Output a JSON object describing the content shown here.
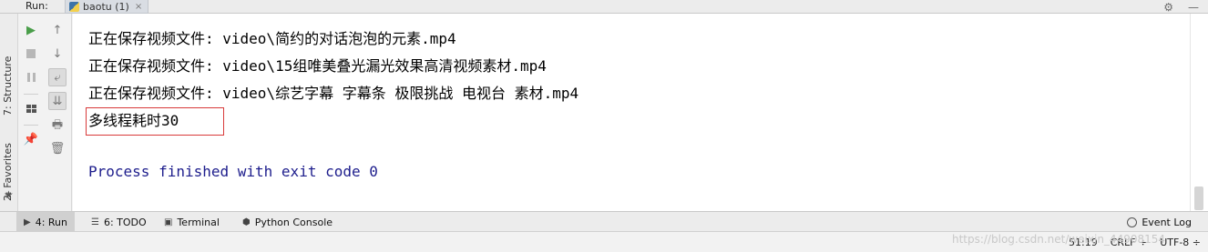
{
  "run_bar": {
    "label": "Run:",
    "tab_name": "baotu (1)",
    "tab_close": "×",
    "settings_glyph": "⚙",
    "minimize_glyph": "—"
  },
  "left_stripe": {
    "structure_label": "7: Structure",
    "favorites_label": "2: Favorites",
    "favorites_icon": "star-icon"
  },
  "console": {
    "lines": [
      "正在保存视频文件: video\\简约的对话泡泡的元素.mp4",
      "正在保存视频文件: video\\15组唯美叠光漏光效果高清视频素材.mp4",
      "正在保存视频文件: video\\综艺字幕 字幕条 极限挑战 电视台 素材.mp4",
      "多线程耗时30"
    ],
    "exit_message": "Process finished with exit code 0",
    "highlight_color": "#d83a3a",
    "exit_color": "#1d1d8c"
  },
  "bottom_tabs": [
    {
      "label": "4: Run",
      "icon": "play-icon"
    },
    {
      "label": "6: TODO",
      "icon": "list-icon"
    },
    {
      "label": "Terminal",
      "icon": "terminal-icon"
    },
    {
      "label": "Python Console",
      "icon": "python-icon"
    }
  ],
  "event_log": {
    "label": "Event Log"
  },
  "status": {
    "position": "51:19",
    "line_separator": "CRLF ÷",
    "encoding": "UTF-8 ÷"
  },
  "watermark": "https://blog.csdn.net/weixin_44908154"
}
